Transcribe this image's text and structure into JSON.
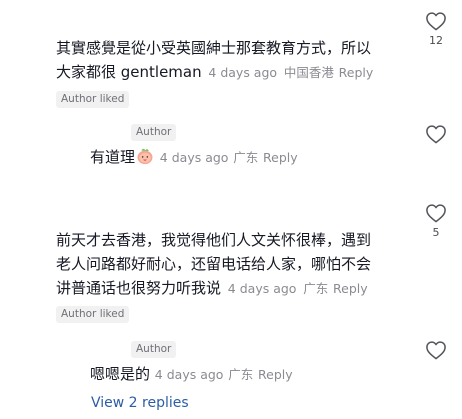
{
  "comment1": {
    "text_line1": "其實感覺是從小受英國紳士那套教育方式，所以",
    "text_line2": "大家都很 gentleman",
    "time": "4 days ago",
    "location": "中国香港",
    "reply_label": "Reply",
    "badge": "Author liked",
    "likes": "12"
  },
  "reply1": {
    "author_pill": "Author",
    "text": "有道理",
    "emoji": "peach-face-emoji",
    "time": "4 days ago",
    "location": "广东",
    "reply_label": "Reply"
  },
  "comment2": {
    "text_line1": "前天才去香港，我觉得他们人文关怀很棒，遇到",
    "text_line2": "老人问路都好耐心，还留电话给人家，哪怕不会",
    "text_line3": "讲普通话也很努力听我说",
    "time": "4 days ago",
    "location": "广东",
    "reply_label": "Reply",
    "badge": "Author liked",
    "likes": "5"
  },
  "reply2": {
    "author_pill": "Author",
    "text": "嗯嗯是的",
    "time": "4 days ago",
    "location": "广东",
    "reply_label": "Reply"
  },
  "view_replies": "View 2 replies",
  "colors": {
    "text": "#161823",
    "meta": "#8a8b91",
    "link": "#2b5da7",
    "pill_bg": "#f1f1f2"
  }
}
